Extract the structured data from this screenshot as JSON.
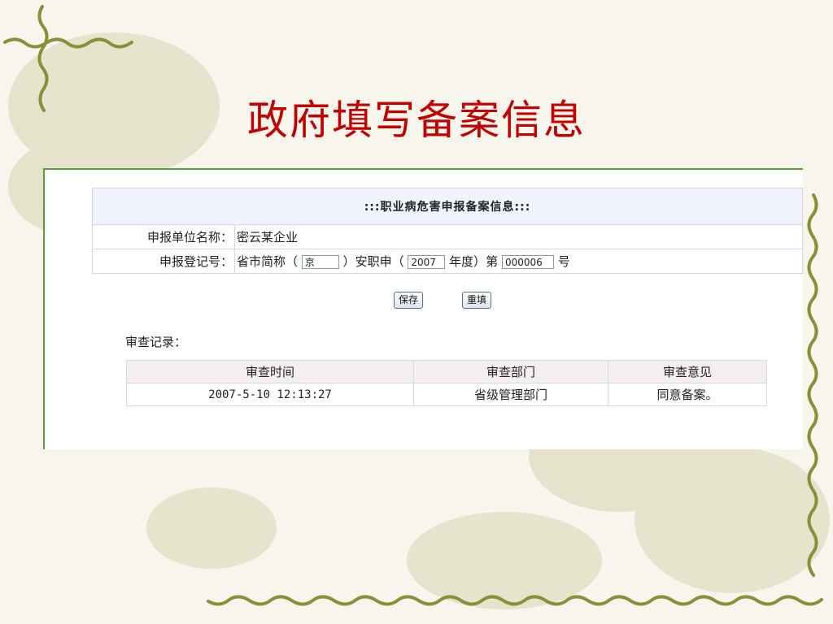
{
  "slide": {
    "title": "政府填写备案信息"
  },
  "form": {
    "header": ":::职业病危害申报备案信息:::",
    "org_label": "申报单位名称：",
    "org_value": "密云某企业",
    "reg_label": "申报登记号：",
    "reg_prefix": "省市简称（",
    "province_value": "京",
    "reg_mid": "）安职申（",
    "year_value": "2007",
    "reg_year_suffix": "年度）第",
    "serial_value": "000006",
    "reg_suffix": "号"
  },
  "buttons": {
    "save": "保存",
    "reset": "重填"
  },
  "review": {
    "section_label": "审查记录：",
    "columns": [
      "审查时间",
      "审查部门",
      "审查意见"
    ],
    "rows": [
      [
        "2007-5-10 12:13:27",
        "省级管理部门",
        "同意备案。"
      ]
    ]
  }
}
